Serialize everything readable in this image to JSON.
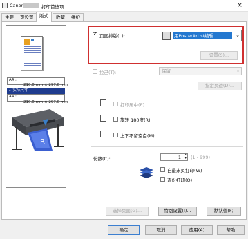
{
  "window": {
    "title_prefix": "Canon",
    "title": "打印首选项",
    "close": "×"
  },
  "tabs": [
    "主要",
    "页设置",
    "版式",
    "收藏",
    "维护"
  ],
  "preview": {
    "size1_label": "A4 :",
    "size1_value": "210.0 mm × 297.0 mm",
    "arrow_label": "↓ 实际尺寸",
    "size2_label": "A4 :",
    "size2_value": "210.0 mm × 297.0 mm"
  },
  "page_layout": {
    "checkbox_label": "页面排版(L):",
    "checked": true,
    "selected": "用PosterArtist编辑",
    "settings_button": "设置(S)..."
  },
  "position": {
    "label": "拉己(T):",
    "value": "保留",
    "specify_button": "指定页边(D)..."
  },
  "options": {
    "print_centered": "打印居中(E)",
    "rotate": "旋转 180度(R)",
    "no_blank": "上下不留空白(M)"
  },
  "copies": {
    "label": "份数(C):",
    "value": "1",
    "range": "(1 - 999)",
    "last_page_first": "自最末页打印(W)",
    "collate": "逐份打印(O)"
  },
  "footer_buttons": {
    "select_pages": "选择页面(G)...",
    "special": "特别设置(I)...",
    "defaults": "默认值(F)"
  },
  "dialog_buttons": [
    "确定",
    "取消",
    "应用(A)",
    "帮助"
  ]
}
